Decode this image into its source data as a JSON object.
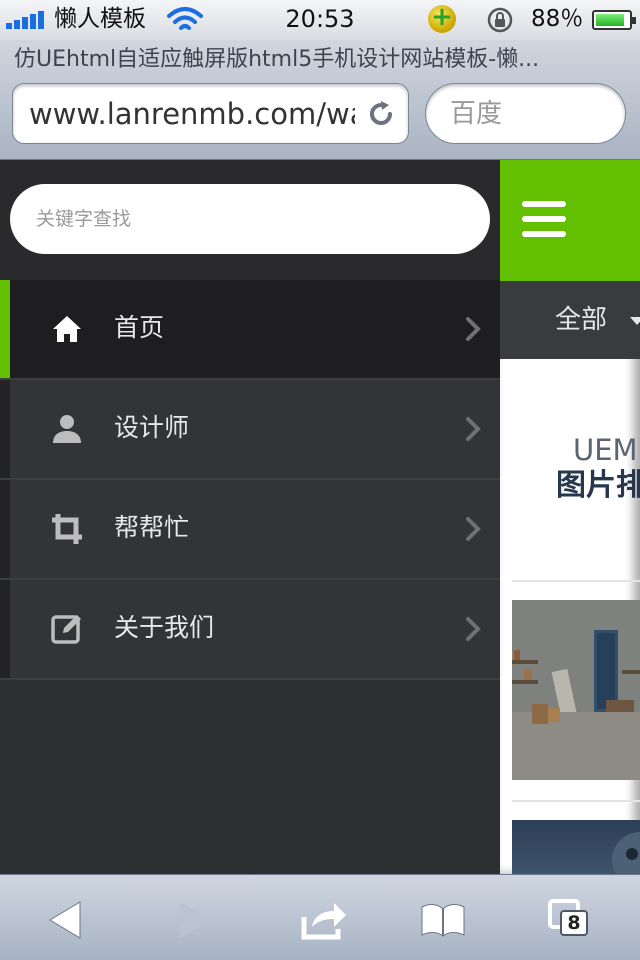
{
  "status_bar": {
    "carrier": "懒人模板",
    "time": "20:53",
    "battery_percent": "88％",
    "battery_level": 0.88,
    "icons": [
      "signal-icon",
      "wifi-icon",
      "app-badge-icon",
      "rotation-lock-icon",
      "battery-icon"
    ]
  },
  "browser": {
    "page_title": "仿UEhtml自适应触屏版html5手机设计网站模板-懒...",
    "url": "www.lanrenmb.com/wap",
    "search_placeholder": "百度",
    "tab_count": "8",
    "toolbar_icons": [
      "back-icon",
      "forward-icon",
      "share-icon",
      "bookmarks-icon",
      "tabs-icon"
    ]
  },
  "side_menu": {
    "search_placeholder": "关键字查找",
    "items": [
      {
        "label": "首页",
        "icon": "home-icon",
        "active": true
      },
      {
        "label": "设计师",
        "icon": "user-icon",
        "active": false
      },
      {
        "label": "帮帮忙",
        "icon": "crop-icon",
        "active": false
      },
      {
        "label": "关于我们",
        "icon": "edit-icon",
        "active": false
      }
    ]
  },
  "main": {
    "filter_label": "全部",
    "hero_en": "UEM",
    "hero_cn": "图片排"
  },
  "colors": {
    "accent": "#63c000",
    "menu_bg": "#333438",
    "menu_active_bg": "#1e1e20"
  }
}
